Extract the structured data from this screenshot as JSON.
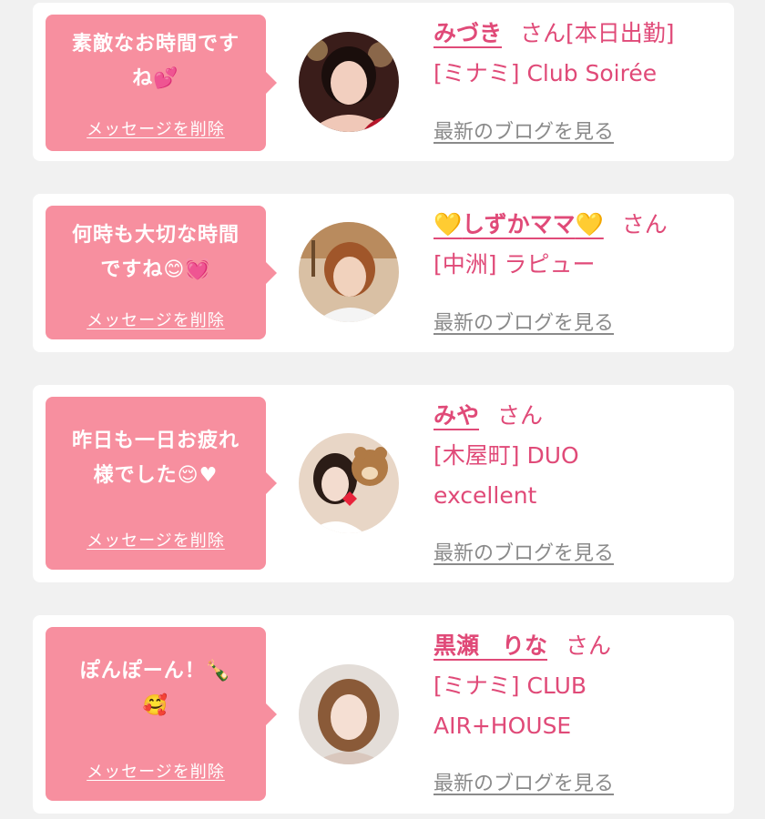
{
  "cards": [
    {
      "message_lines": [
        "素敵なお時間です",
        "ね💕"
      ],
      "delete_label": "メッセージを削除",
      "name": "みづき",
      "honorific": "さん",
      "status": "[本日出勤]",
      "area_shop_lines": [
        "[ミナミ] Club Soirée"
      ],
      "blog_link": "最新のブログを見る"
    },
    {
      "message_lines": [
        "何時も大切な時間",
        "ですね😊💓"
      ],
      "delete_label": "メッセージを削除",
      "name_prefix_icon": "💛",
      "name": "しずかママ",
      "name_suffix_icon": "💛",
      "honorific": "さん",
      "area_shop_lines": [
        "[中洲] ラピュー"
      ],
      "blog_link": "最新のブログを見る"
    },
    {
      "message_lines": [
        "昨日も一日お疲れ",
        "様でした😌♥"
      ],
      "delete_label": "メッセージを削除",
      "name": "みや",
      "honorific": "さん",
      "area_shop_lines": [
        "[木屋町] DUO",
        "excellent"
      ],
      "blog_link": "最新のブログを見る"
    },
    {
      "message_lines": [
        "ぽんぽーん！🍾",
        "🥰"
      ],
      "delete_label": "メッセージを削除",
      "name": "黒瀬　りな",
      "honorific": "さん",
      "area_shop_lines": [
        "[ミナミ] CLUB",
        "AIR+HOUSE"
      ],
      "blog_link": "最新のブログを見る"
    }
  ],
  "colors": {
    "accent": "#e04a78",
    "bubble": "#f78f9f",
    "link_gray": "#8a8a8a",
    "background": "#f1f1f1"
  },
  "icons": {
    "avatar": "profile-photo"
  }
}
